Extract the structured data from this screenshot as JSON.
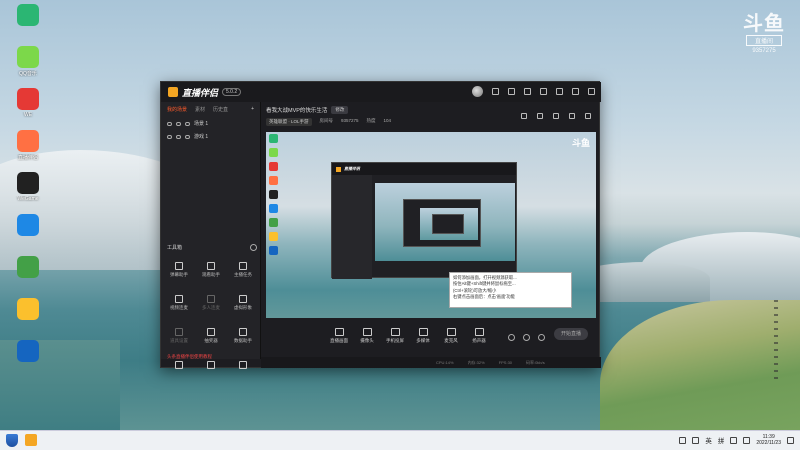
{
  "desktop": {
    "icons": [
      {
        "label": "",
        "color": "#2bb673"
      },
      {
        "label": "",
        "color": "#4fc3f7"
      },
      {
        "label": "QQ音乐",
        "color": "#7cd84a"
      },
      {
        "label": "WE",
        "color": "#e53935"
      },
      {
        "label": "",
        "color": "#ff8a65"
      },
      {
        "label": "直播伴侣",
        "color": "#ff7043"
      },
      {
        "label": "WeGame",
        "color": "#212121"
      },
      {
        "label": "",
        "color": "#1e88e5"
      },
      {
        "label": "",
        "color": "#43a047"
      },
      {
        "label": "",
        "color": "#fbc02d"
      },
      {
        "label": "",
        "color": "#e53935"
      },
      {
        "label": "",
        "color": "#1565c0"
      }
    ],
    "watermark": {
      "logo": "斗鱼",
      "sub": "直播间",
      "id": "9357275"
    }
  },
  "app": {
    "title": "直播伴侣",
    "version": "5.0.2",
    "left_tabs": [
      "我的场景",
      "素材",
      "历史直"
    ],
    "scenes": [
      "场景 1",
      "游戏 1"
    ],
    "tools_title": "工具箱",
    "tools": [
      {
        "label": "弹幕助手",
        "dim": false
      },
      {
        "label": "观看助手",
        "dim": false
      },
      {
        "label": "主播任务",
        "dim": false
      },
      {
        "label": "视频连麦",
        "dim": false
      },
      {
        "label": "多人连麦",
        "dim": true
      },
      {
        "label": "虚拟形象",
        "dim": false
      },
      {
        "label": "道具设置",
        "dim": true
      },
      {
        "label": "抽奖器",
        "dim": false
      },
      {
        "label": "数据助手",
        "dim": false
      },
      {
        "label": "",
        "dim": false
      },
      {
        "label": "",
        "dim": false
      },
      {
        "label": "",
        "dim": false
      }
    ],
    "bottom_notice": "头条直播伴侣使用教程",
    "room": {
      "title": "看我大战MVP的快乐生活",
      "edit_btn": "修改",
      "category": "英雄联盟 · LOL手游",
      "room_no": "房间号",
      "room_id": "9357275",
      "hot_label": "热度",
      "hot": "104"
    },
    "preview": {
      "watermark": "斗鱼",
      "nested_title": "直播伴侣",
      "tooltip": [
        "如何添加画面，打开视频源获取...",
        "按住Alt键+Shift键并将鼠标拖至...",
        "(Ctrl+滚轮)可放大/缩小",
        "右键点击画面后：点击'画面'功能"
      ]
    },
    "controls": [
      "直播画面",
      "摄像头",
      "手机投屏",
      "多媒体",
      "麦克风",
      "扬声器"
    ],
    "start_button": "开始直播",
    "status": [
      "CPU:14%",
      "内存:32%",
      "FPS:30",
      "码率:0kb/s"
    ]
  },
  "taskbar": {
    "tray_lang": "英",
    "tray_extra": "拼",
    "time": "11:39",
    "date": "2022/11/23"
  }
}
